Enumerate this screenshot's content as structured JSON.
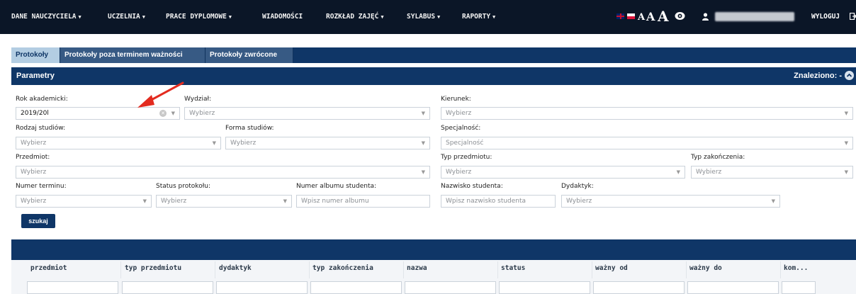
{
  "topnav": {
    "items": [
      "DANE NAUCZYCIELA",
      "UCZELNIA",
      "PRACE DYPLOMOWE",
      "WIADOMOŚCI",
      "ROZKŁAD ZAJĘĆ",
      "SYLABUS",
      "RAPORTY"
    ],
    "font_size_a_small": "A",
    "font_size_a_medium": "A",
    "font_size_a_large": "A",
    "logout": "WYLOGUJ"
  },
  "tabs": [
    "Protokoły",
    "Protokoły poza terminem ważności",
    "Protokoły zwrócone"
  ],
  "params": {
    "title": "Parametry",
    "found": "Znaleziono: -"
  },
  "filters": {
    "rok_label": "Rok akademicki:",
    "rok_value": "2019/20l",
    "wydzial_label": "Wydział:",
    "wydzial_value": "Wybierz",
    "kierunek_label": "Kierunek:",
    "kierunek_value": "Wybierz",
    "rodzaj_label": "Rodzaj studiów:",
    "rodzaj_value": "Wybierz",
    "forma_label": "Forma studiów:",
    "forma_value": "Wybierz",
    "specjalnosc_label": "Specjalność:",
    "specjalnosc_value": "Specjalność",
    "przedmiot_label": "Przedmiot:",
    "przedmiot_value": "Wybierz",
    "typ_przedmiotu_label": "Typ przedmiotu:",
    "typ_przedmiotu_value": "Wybierz",
    "typ_zakonczenia_label": "Typ zakończenia:",
    "typ_zakonczenia_value": "Wybierz",
    "numer_terminu_label": "Numer terminu:",
    "numer_terminu_value": "Wybierz",
    "status_label": "Status protokołu:",
    "status_value": "Wybierz",
    "album_label": "Numer albumu studenta:",
    "album_placeholder": "Wpisz numer albumu",
    "nazwisko_label": "Nazwisko studenta:",
    "nazwisko_placeholder": "Wpisz nazwisko studenta",
    "dydaktyk_label": "Dydaktyk:",
    "dydaktyk_value": "Wybierz",
    "search_button": "szukaj"
  },
  "table": {
    "columns": [
      "przedmiot",
      "typ przedmiotu",
      "dydaktyk",
      "typ zakończenia",
      "nazwa",
      "status",
      "ważny od",
      "ważny do",
      "kom..."
    ]
  },
  "colors": {
    "nav_bg": "#0b1627",
    "primary": "#0f3667",
    "tab_active": "#b3cde2",
    "tab_inactive": "#375a84",
    "arrow": "#e32b1f"
  },
  "icons": [
    "uk-flag-icon",
    "pl-flag-icon",
    "eye-icon",
    "user-icon",
    "logout-icon",
    "collapse-icon",
    "clear-icon",
    "chevron-down-icon",
    "red-arrow-annotation"
  ]
}
